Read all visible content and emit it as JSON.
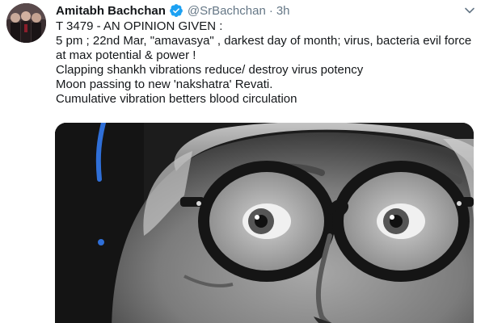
{
  "tweet": {
    "author_name": "Amitabh Bachchan",
    "handle": "@SrBachchan",
    "separator": "·",
    "timestamp": "3h",
    "verified": true,
    "icons": {
      "verified": "verified-badge-icon",
      "menu": "chevron-down-icon"
    },
    "colors": {
      "verified_badge": "#1da1f2",
      "secondary_text": "#657786",
      "primary_text": "#14171a"
    },
    "text_lines": [
      "T 3479 - AN OPINION GIVEN :",
      "5 pm ; 22nd Mar, \"amavasya\" , darkest day of month; virus, bacteria evil force",
      "at max potential & power !",
      "Clapping shankh vibrations reduce/ destroy virus potency",
      "Moon passing to new 'nakshatra' Revati.",
      "Cumulative vibration betters blood circulation"
    ]
  }
}
